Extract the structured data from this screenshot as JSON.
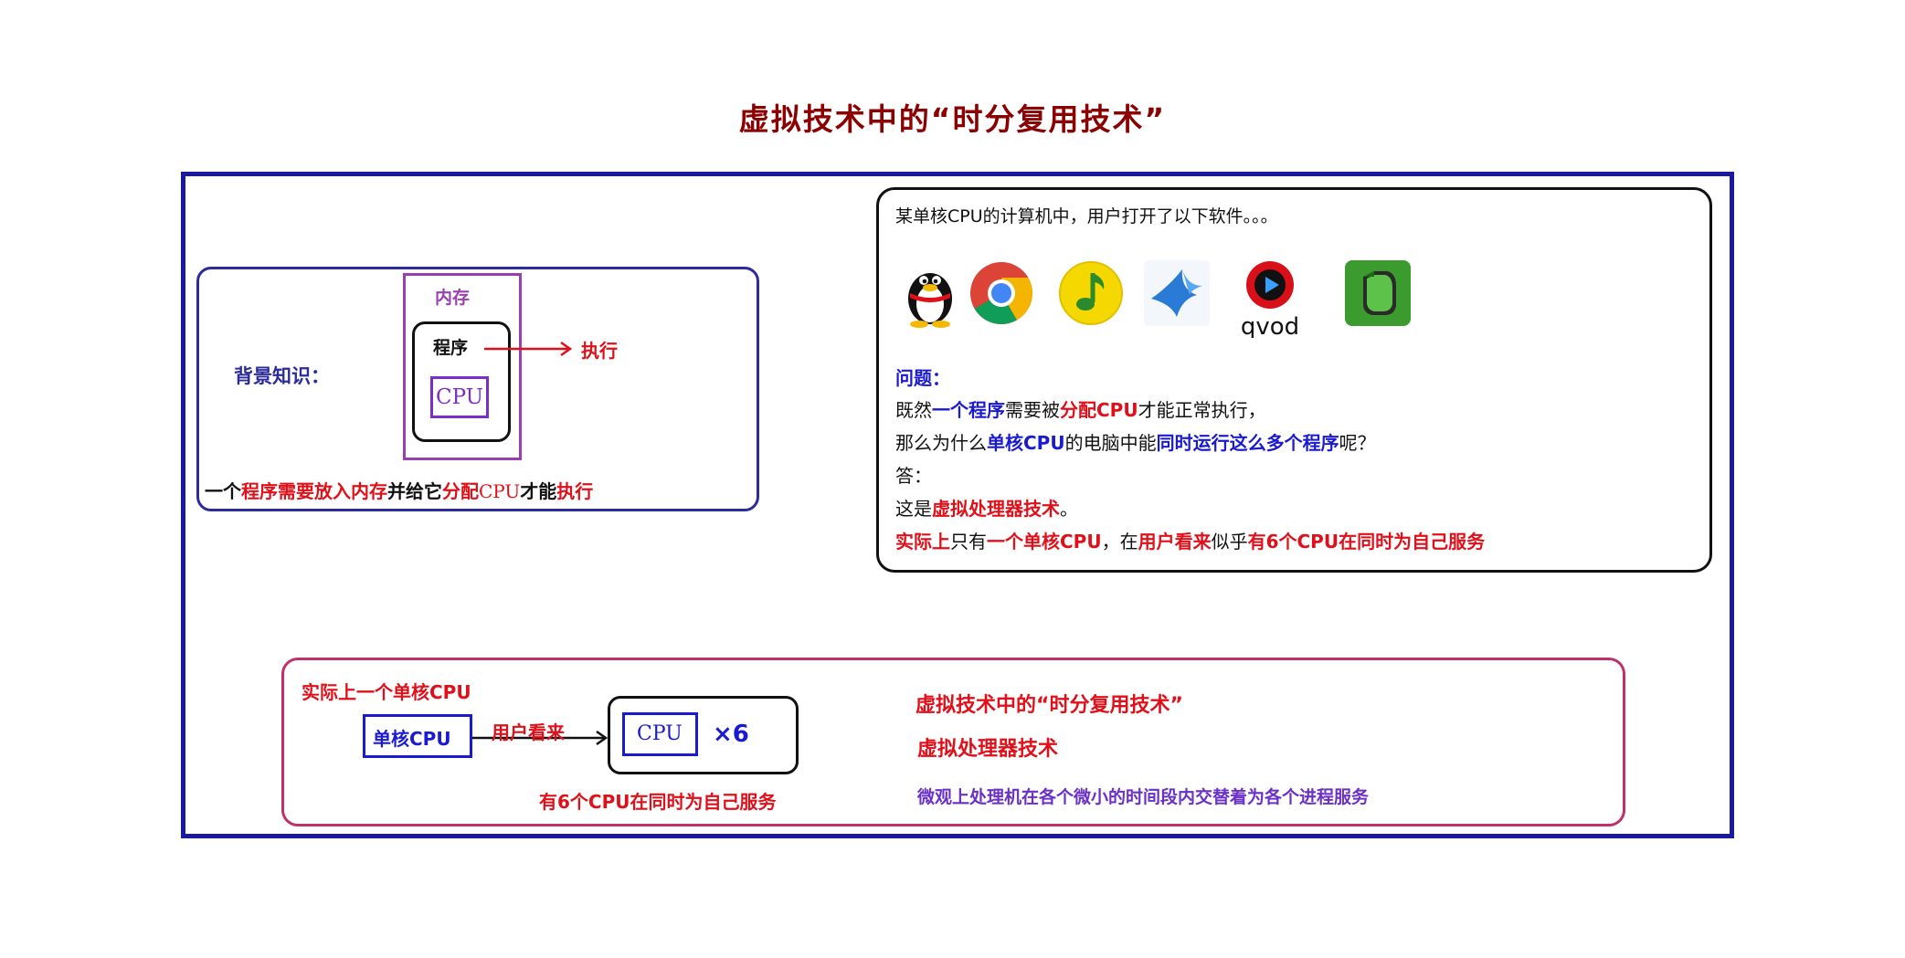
{
  "title": "虚拟技术中的“时分复用技术”",
  "background": {
    "label": "背景知识：",
    "memory": "内存",
    "program": "程序",
    "cpu": "CPU",
    "execute": "执行",
    "caption": [
      {
        "text": "一个",
        "color": "black"
      },
      {
        "text": "程序需要放入内存",
        "color": "red"
      },
      {
        "text": "并给它",
        "color": "black"
      },
      {
        "text": "分配",
        "color": "red"
      },
      {
        "text": "CPU",
        "color": "red"
      },
      {
        "text": "才能",
        "color": "black"
      },
      {
        "text": "执行",
        "color": "red"
      }
    ]
  },
  "question_panel": {
    "intro": "某单核CPU的计算机中，用户打开了以下软件。。。",
    "icons": [
      "qq-penguin-icon",
      "chrome-icon",
      "qq-music-icon",
      "xunlei-bird-icon",
      "qvod-icon",
      "evernote-icon"
    ],
    "qvod_text": "qvod",
    "question_label": "问题：",
    "line1": [
      {
        "text": "既然",
        "color": "black"
      },
      {
        "text": "一个程序",
        "color": "blue"
      },
      {
        "text": "需要被",
        "color": "black"
      },
      {
        "text": "分配CPU",
        "color": "red"
      },
      {
        "text": "才能正常执行，",
        "color": "black"
      }
    ],
    "line2": [
      {
        "text": "那么为什么",
        "color": "black"
      },
      {
        "text": "单核CPU",
        "color": "blue"
      },
      {
        "text": "的电脑中能",
        "color": "black"
      },
      {
        "text": "同时运行这么多个程序",
        "color": "blue"
      },
      {
        "text": "呢？",
        "color": "black"
      }
    ],
    "answer_label": "答：",
    "line3": [
      {
        "text": "这是",
        "color": "black"
      },
      {
        "text": "虚拟处理器技术",
        "color": "red"
      },
      {
        "text": "。",
        "color": "black"
      }
    ],
    "line4": [
      {
        "text": "实际上",
        "color": "red"
      },
      {
        "text": "只有",
        "color": "black"
      },
      {
        "text": "一个单核CPU",
        "color": "red"
      },
      {
        "text": "，在",
        "color": "black"
      },
      {
        "text": "用户看来",
        "color": "red"
      },
      {
        "text": "似乎",
        "color": "black"
      },
      {
        "text": "有6个CPU在同时为自己服务",
        "color": "red"
      }
    ]
  },
  "bottom": {
    "actual": "实际上一个单核CPU",
    "single_core": "单核CPU",
    "user_view": "用户看来",
    "cpu": "CPU",
    "times": "×6",
    "six_cpu": "有6个CPU在同时为自己服务",
    "heading1": "虚拟技术中的“时分复用技术”",
    "heading2": "虚拟处理器技术",
    "description": "微观上处理机在各个微小的时间段内交替着为各个进程服务"
  },
  "colors": {
    "title": "#8b0000",
    "frame": "#1a1aa0",
    "red": "#e0101a",
    "blue": "#1a1ad0",
    "purple": "#6a30c8",
    "memory": "#9b3fb0",
    "bottom_frame": "#c0306a"
  }
}
